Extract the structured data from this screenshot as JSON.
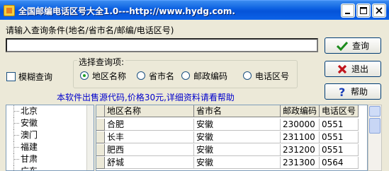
{
  "window": {
    "title": "全国邮编电话区号大全1.0---http://www.hydg.com."
  },
  "search": {
    "prompt": "请输入查询条件(地名/省市名/邮编/电话区号)",
    "value": ""
  },
  "buttons": {
    "query": "查询",
    "exit": "退出",
    "help": "帮助"
  },
  "fuzzy": {
    "label": "模糊查询",
    "checked": false
  },
  "options": {
    "legend": "选择查询项:",
    "items": [
      {
        "label": "地区名称",
        "selected": true
      },
      {
        "label": "省市名",
        "selected": false
      },
      {
        "label": "邮政编码",
        "selected": false
      },
      {
        "label": "电话区号",
        "selected": false
      }
    ]
  },
  "promo": "本软件出售源代码,价格30元,详细资料请看帮助",
  "tree": {
    "items": [
      "北京",
      "安徽",
      "澳门",
      "福建",
      "甘肃",
      "广东"
    ]
  },
  "grid": {
    "columns": [
      "地区名称",
      "省市名",
      "邮政编码",
      "电话区号"
    ],
    "rows": [
      [
        "合肥",
        "安徽",
        "230000",
        "0551"
      ],
      [
        "长丰",
        "安徽",
        "231100",
        "0551"
      ],
      [
        "肥西",
        "安徽",
        "231200",
        "0551"
      ],
      [
        "舒城",
        "安徽",
        "231300",
        "0564"
      ]
    ]
  },
  "colors": {
    "accent": "#0054e3",
    "promo": "#0000cc"
  }
}
